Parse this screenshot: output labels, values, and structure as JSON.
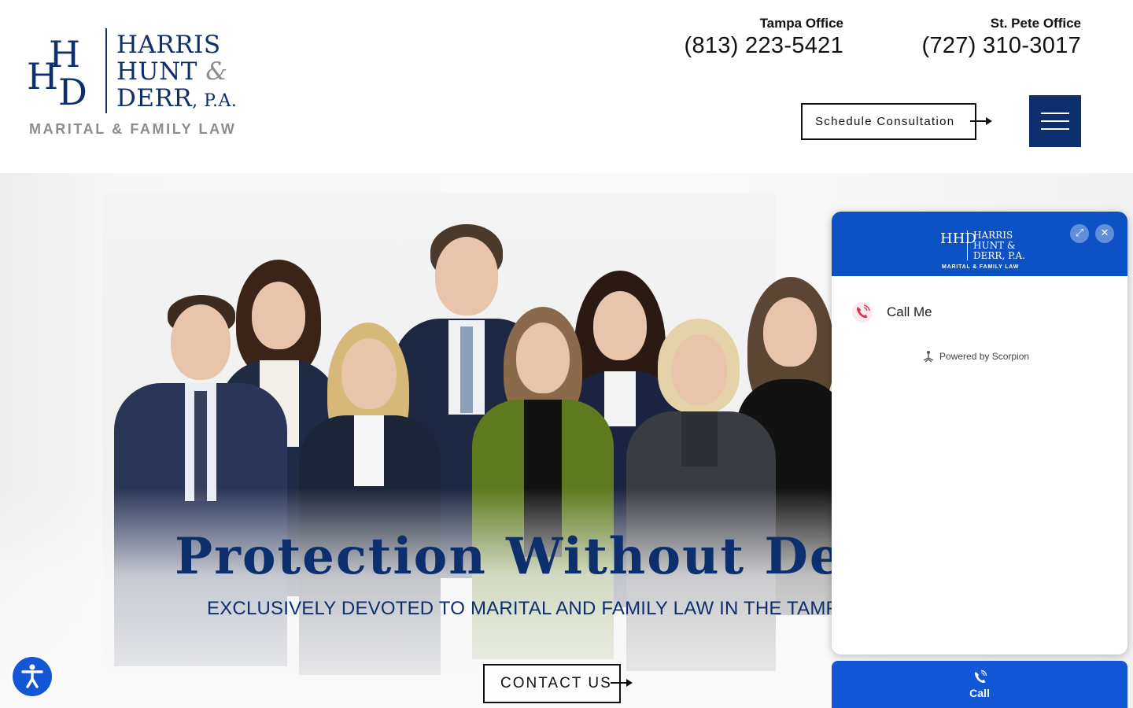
{
  "header": {
    "logo": {
      "monogram": [
        "H",
        "H",
        "D"
      ],
      "words": [
        "HARRIS",
        "HUNT",
        "&",
        "DERR",
        ", P.A."
      ],
      "tagline": "MARITAL & FAMILY LAW"
    },
    "offices": [
      {
        "name": "Tampa Office",
        "phone": "(813) 223-5421"
      },
      {
        "name": "St. Pete Office",
        "phone": "(727) 310-3017"
      }
    ],
    "schedule_label": "Schedule Consultation",
    "menu_icon": "hamburger-menu-icon"
  },
  "hero": {
    "title": "Protection Without Destruction",
    "subtitle": "EXCLUSIVELY DEVOTED TO MARITAL AND FAMILY LAW IN THE TAMPA BAY AREA",
    "contact_label": "CONTACT US",
    "watermark": "H"
  },
  "chat_widget": {
    "logo": {
      "monogram": "HHD",
      "words": [
        "HARRIS",
        "HUNT &",
        "DERR, P.A."
      ],
      "tagline": "MARITAL & FAMILY LAW"
    },
    "expand_icon": "expand-icon",
    "close_icon": "close-icon",
    "call_me_label": "Call Me",
    "powered_by": "Powered by Scorpion"
  },
  "call_bar": {
    "label": "Call"
  },
  "accessibility_icon": "accessibility-icon",
  "colors": {
    "brand_navy": "#0d2f6e",
    "widget_blue": "#0d52c4",
    "call_blue": "#1457d6",
    "gray_text": "#8a8d91"
  }
}
